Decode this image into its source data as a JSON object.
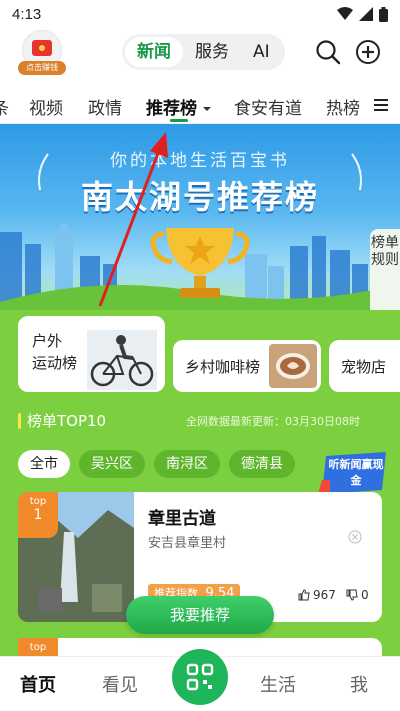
{
  "status": {
    "time": "4:13"
  },
  "header": {
    "red_packet_label": "点击赚钱",
    "segments": [
      "新闻",
      "服务",
      "AI"
    ],
    "active_segment": "新闻"
  },
  "tabs": {
    "items": [
      "条",
      "视频",
      "政情",
      "推荐榜",
      "食安有道",
      "热榜"
    ],
    "active": "推荐榜"
  },
  "hero": {
    "subtitle": "你的本地生活百宝书",
    "title": "南太湖号推荐榜",
    "side_tab": "榜单规则"
  },
  "categories": [
    {
      "label": "户外\n运动榜"
    },
    {
      "label": "乡村咖啡榜"
    },
    {
      "label": "宠物店"
    }
  ],
  "ranking": {
    "heading": "榜单TOP10",
    "update_text": "全网数据最新更新：03月30日08时",
    "chips": [
      "全市",
      "吴兴区",
      "南浔区",
      "德清县"
    ],
    "active_chip": "全市",
    "promo_badge": "听新闻赢现金"
  },
  "items": [
    {
      "rank_prefix": "top",
      "rank": "1",
      "name": "章里古道",
      "location": "安吉县章里村",
      "index_label": "推荐指数",
      "index_value": "9.54",
      "likes": "967",
      "dislikes": "0"
    },
    {
      "rank_prefix": "top"
    }
  ],
  "recommend_button": "我要推荐",
  "bottom_nav": {
    "items": [
      "首页",
      "看见",
      "生活",
      "我"
    ],
    "active": "首页"
  },
  "colors": {
    "brand_green": "#1a9a4a",
    "panel_green": "#7ccf3f",
    "rank_orange": "#f08a2a",
    "annotation_red": "#e02020"
  }
}
